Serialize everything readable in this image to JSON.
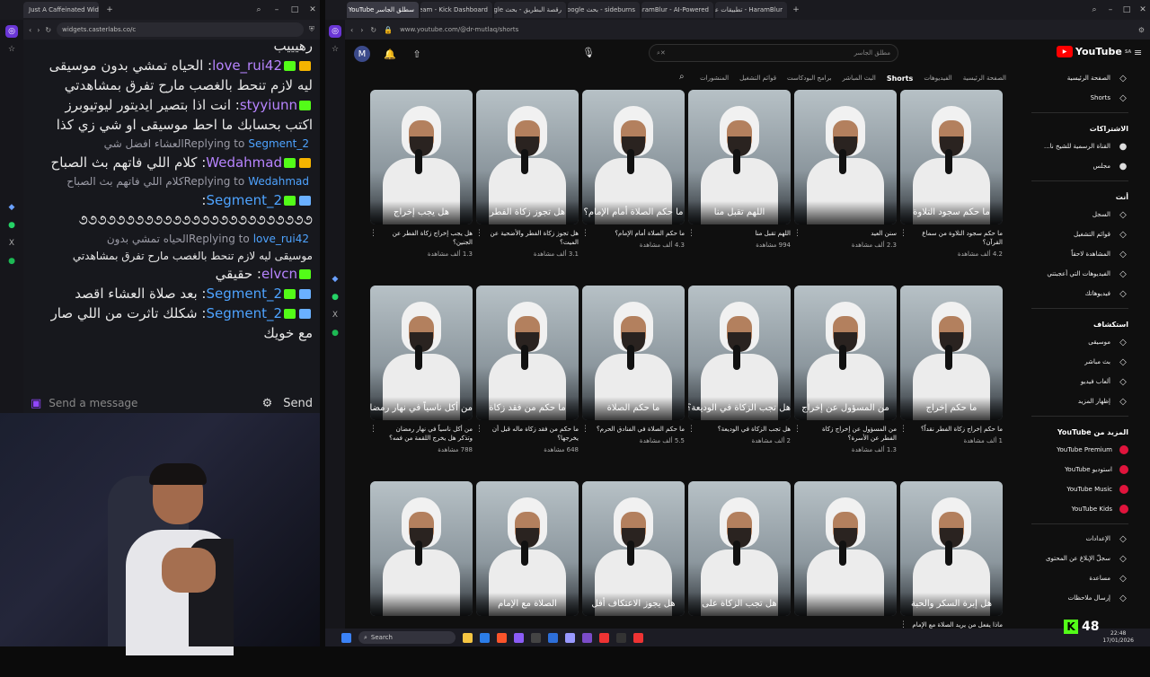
{
  "left_browser": {
    "tabs": [
      "Just A Caffeinated Widget"
    ],
    "url": "widgets.casterlabs.co/c"
  },
  "chat": {
    "top_partial": "رهيييب",
    "messages": [
      {
        "user": "love_rui42",
        "badges": [
          "crown",
          "kick"
        ],
        "text": "الحياه تمشي بدون موسيقى"
      },
      {
        "user": "",
        "badges": [],
        "text": "ليه لازم تنحط بالغصب مارح تفرق بمشاهدتي"
      },
      {
        "user": "styyiunn",
        "badges": [
          "kick"
        ],
        "text": "انت اذا بتصير ايديتور ليوتيوبرز"
      },
      {
        "user": "",
        "badges": [],
        "text": "اكتب بحسابك ما احط موسيقى او شي زي كذا"
      },
      {
        "reply": true,
        "to": "Segment_2",
        "text": "العشاء افضل شي"
      },
      {
        "user": "Wedahmad",
        "badges": [
          "crown",
          "kick"
        ],
        "text": "كلام اللي فاتهم بث الصباح"
      },
      {
        "reply": true,
        "to": "Wedahmad",
        "text": "كلام اللي فاتهم بث الصباح"
      },
      {
        "user": "Segment_2",
        "badges": [
          "sword",
          "kick"
        ],
        "text": ""
      },
      {
        "user": "",
        "badges": [],
        "text": "૭૭૭૭૭૭૭૭૭૭૭૭૭૭૭૭૭૭૭૭૭૭૭૭૭"
      },
      {
        "reply": true,
        "to": "love_rui42",
        "text": "الحياه تمشي بدون"
      },
      {
        "user": "",
        "badges": [],
        "text": "موسيقى ليه لازم تنحط بالغصب مارح تفرق بمشاهدتي",
        "small": true
      },
      {
        "user": "elvcn",
        "badges": [
          "kick"
        ],
        "text": "حقيقي"
      },
      {
        "user": "Segment_2",
        "badges": [
          "sword",
          "kick"
        ],
        "text": "بعد صلاة العشاء اقصد"
      },
      {
        "user": "Segment_2",
        "badges": [
          "sword",
          "kick"
        ],
        "text": "شكلك تاثرت من اللي صار"
      },
      {
        "user": "",
        "badges": [],
        "text": "مع خويك"
      }
    ],
    "replying_label": "Replying to",
    "input_placeholder": "Send a message",
    "send_label": "Send"
  },
  "right_browser": {
    "tabs": [
      "سطلق الجاسر YouTube - د",
      "Stream - Kick Dashboard",
      "رقصة البطريق - بحث Google",
      "sideburns - بحث Google",
      "HaramBlur - AI-Powered",
      "HaramBlur - تطبيقات على"
    ],
    "url": "www.youtube.com/@dr-mutlaq/shorts"
  },
  "youtube": {
    "avatar_letter": "M",
    "search_placeholder": "مطلق الجاسر",
    "logo": "YouTube",
    "logo_region": "SA",
    "channel_tabs": [
      "الصفحة الرئيسية",
      "الفيديوهات",
      "Shorts",
      "البث المباشر",
      "برامج البودكاست",
      "قوائم التشغيل",
      "المنشورات"
    ],
    "active_tab": "Shorts",
    "shorts": [
      {
        "caption": "ما حكم سجود التلاوة",
        "title": "ما حكم سجود التلاوة من سماع القرآن؟",
        "views": "4.2 ألف مشاهدة"
      },
      {
        "caption": "",
        "title": "سنن العيد",
        "views": "2.3 ألف مشاهدة"
      },
      {
        "caption": "اللهم تقبل منا",
        "title": "اللهم تقبل منا",
        "views": "994 مشاهدة"
      },
      {
        "caption": "ما حكم الصلاة أمام الإمام؟",
        "title": "ما حكم الصلاة أمام الإمام؟",
        "views": "4.3 ألف مشاهدة"
      },
      {
        "caption": "هل تجوز زكاة الفطر",
        "title": "هل تجوز زكاة الفطر والأضحية عن الميت؟",
        "views": "3.1 ألف مشاهدة"
      },
      {
        "caption": "هل يجب إخراج",
        "title": "هل يجب إخراج زكاة الفطر عن الجنين؟",
        "views": "1.3 ألف مشاهدة"
      },
      {
        "caption": "ما حكم إخراج",
        "title": "ما حكم إخراج زكاة الفطر نقداً؟",
        "views": "1 ألف مشاهدة"
      },
      {
        "caption": "من المسؤول عن إخراج",
        "title": "من المسؤول عن إخراج زكاة الفطر عن الأسرة؟",
        "views": "1.3 ألف مشاهدة"
      },
      {
        "caption": "هل تجب الزكاة في الوديعة؟",
        "title": "هل تجب الزكاة في الوديعة؟",
        "views": "2 ألف مشاهدة"
      },
      {
        "caption": "ما حكم الصلاة",
        "title": "ما حكم الصلاة في الفنادق الحرم؟",
        "views": "5.5 ألف مشاهدة"
      },
      {
        "caption": "ما حكم من فقد زكاة",
        "title": "ما حكم من فقد زكاة ماله قبل أن يخرجها؟",
        "views": "648 مشاهدة"
      },
      {
        "caption": "من أكل ناسياً في نهار رمضان",
        "title": "من أكل ناسياً في نهار رمضان وتذكر هل يخرج اللقمة من فمه؟",
        "views": "788 مشاهدة"
      },
      {
        "caption": "هل إبرة السكر والحبة",
        "title": "ماذا يفعل من يريد الصلاة مع الإمام في التراويح ويكمل بعدها في البيت؟",
        "views": ""
      },
      {
        "caption": "",
        "title": "",
        "views": ""
      },
      {
        "caption": "هل تجب الزكاة على",
        "title": "",
        "views": ""
      },
      {
        "caption": "هل يجوز الاعتكاف أقل",
        "title": "",
        "views": ""
      },
      {
        "caption": "الصلاة مع الإمام",
        "title": "",
        "views": ""
      },
      {
        "caption": "",
        "title": "",
        "views": ""
      }
    ],
    "sidebar": {
      "top": [
        {
          "icon": "home-icon",
          "label": "الصفحة الرئيسية"
        },
        {
          "icon": "shorts-icon",
          "label": "Shorts"
        }
      ],
      "subs_header": "الاشتراكات",
      "subs": [
        {
          "label": "القناة الرسمية للشيخ نا..."
        },
        {
          "label": "مجلس"
        }
      ],
      "you_header": "أنت",
      "you": [
        {
          "icon": "history-icon",
          "label": "السجل"
        },
        {
          "icon": "playlist-icon",
          "label": "قوائم التشغيل"
        },
        {
          "icon": "watch-later-icon",
          "label": "المشاهدة لاحقاً"
        },
        {
          "icon": "like-icon",
          "label": "الفيديوهات التي أعجبتني"
        },
        {
          "icon": "video-icon",
          "label": "فيديوهاتك"
        }
      ],
      "explore_header": "استكشاف",
      "explore": [
        {
          "icon": "music-icon",
          "label": "موسيقى"
        },
        {
          "icon": "live-icon",
          "label": "بث مباشر"
        },
        {
          "icon": "gaming-icon",
          "label": "ألعاب فيديو"
        },
        {
          "icon": "news-icon",
          "label": "إظهار المزيد"
        }
      ],
      "more_header": "المزيد من YouTube",
      "more": [
        {
          "label": "YouTube Premium"
        },
        {
          "label": "استوديو YouTube"
        },
        {
          "label": "YouTube Music"
        },
        {
          "label": "YouTube Kids"
        }
      ],
      "settings": [
        {
          "icon": "gear-icon",
          "label": "الإعدادات"
        },
        {
          "icon": "flag-icon",
          "label": "سجلّ الإبلاغ عن المحتوى"
        },
        {
          "icon": "help-icon",
          "label": "مساعدة"
        },
        {
          "icon": "feedback-icon",
          "label": "إرسال ملاحظات"
        }
      ]
    }
  },
  "taskbar": {
    "search_label": "Search",
    "time": "22:48",
    "date": "17/01/2026"
  },
  "kick_overlay": {
    "count": "48"
  }
}
